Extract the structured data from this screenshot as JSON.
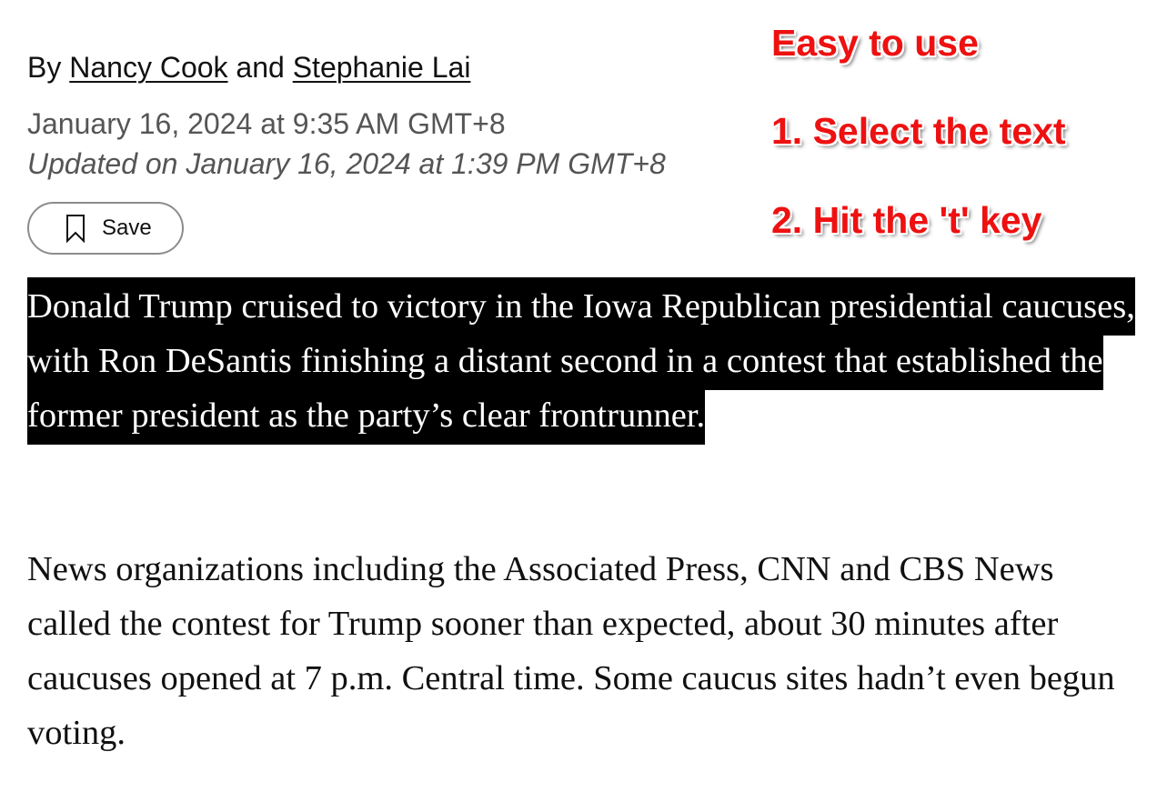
{
  "byline": {
    "prefix": "By ",
    "author1": "Nancy Cook",
    "conjunction": " and ",
    "author2": "Stephanie Lai"
  },
  "dates": {
    "published": "January 16, 2024 at 9:35 AM GMT+8",
    "updated": "Updated on January 16, 2024 at 1:39 PM GMT+8"
  },
  "save": {
    "label": "Save",
    "icon": "bookmark-icon"
  },
  "annotations": {
    "title": "Easy to use",
    "step1": "1. Select the text",
    "step2": "2. Hit the 't' key",
    "color": "#ee1111"
  },
  "article": {
    "lede": "Donald Trump cruised to victory in the Iowa Republican presidential caucuses, with Ron DeSantis finishing a distant second in a contest that established the former president as the party’s clear frontrunner.",
    "second": "News organizations including the Associated Press, CNN and CBS News called the contest for Trump sooner than expected, about 30 minutes after caucuses opened at 7 p.m. Central time. Some caucus sites hadn’t even begun voting.",
    "selection_color": "#000000"
  }
}
